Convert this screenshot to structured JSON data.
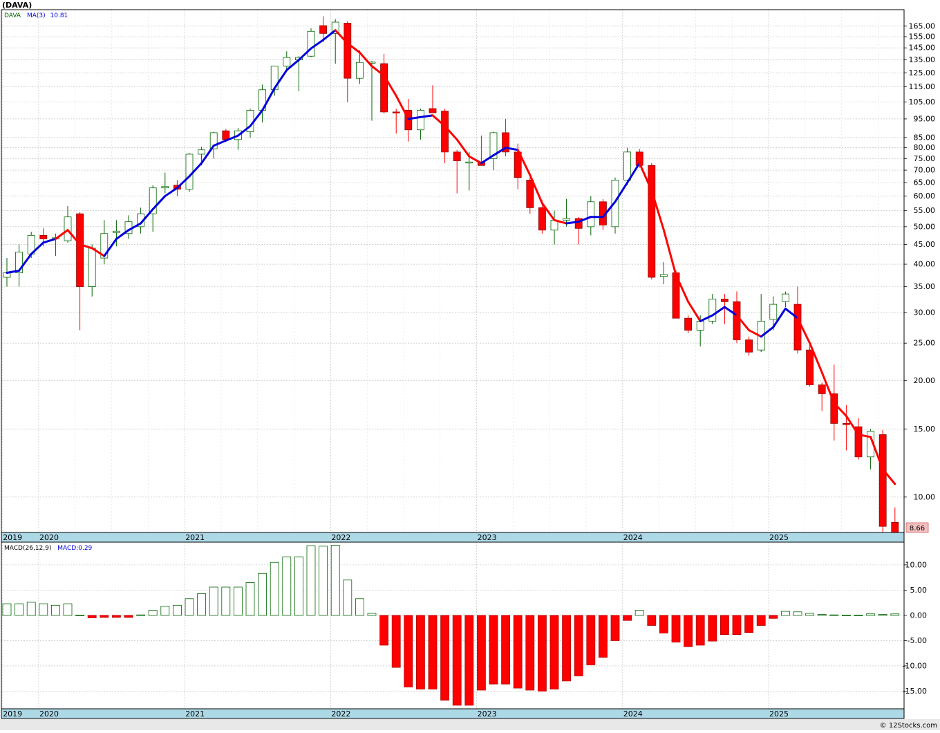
{
  "header": {
    "symbol": "(DAVA)"
  },
  "footer": {
    "credit": "© 12Stocks.com"
  },
  "colors": {
    "up": "#006400",
    "down": "#ff0000",
    "ma_up": "#0000dd",
    "ma_down": "#ff0000",
    "axis_band": "#add8e6",
    "grid": "#b8b8b8"
  },
  "chart_data": [
    {
      "type": "candlestick",
      "legend": {
        "symbol": "DAVA",
        "ma_label": "MA(3)",
        "ma_value": "10.81"
      },
      "last_price_label": "8.66",
      "y_scale": "log",
      "ylim": [
        8.1,
        182
      ],
      "y_ticks": [
        165,
        155,
        145,
        135,
        125,
        115,
        105,
        95,
        85,
        80,
        75,
        70,
        65,
        60,
        55,
        50,
        45,
        40,
        35,
        30,
        25,
        20,
        15,
        10
      ],
      "x_labels": [
        "2019",
        "2020",
        "2021",
        "2022",
        "2023",
        "2024",
        "2025"
      ],
      "x_label_positions": [
        0,
        3,
        15,
        27,
        39,
        51,
        63
      ],
      "grid": true,
      "candles": [
        {
          "o": 37,
          "h": 41.5,
          "l": 35,
          "c": 38
        },
        {
          "o": 38,
          "h": 45,
          "l": 35,
          "c": 43
        },
        {
          "o": 42.5,
          "h": 48.5,
          "l": 41.5,
          "c": 47.5
        },
        {
          "o": 47.5,
          "h": 49.5,
          "l": 44.5,
          "c": 46.5
        },
        {
          "o": 46.5,
          "h": 48,
          "l": 42,
          "c": 46.8
        },
        {
          "o": 46,
          "h": 56.5,
          "l": 45.5,
          "c": 53
        },
        {
          "o": 54,
          "h": 54.5,
          "l": 27,
          "c": 35
        },
        {
          "o": 35,
          "h": 45,
          "l": 33,
          "c": 44
        },
        {
          "o": 41.5,
          "h": 52,
          "l": 40,
          "c": 48
        },
        {
          "o": 48.3,
          "h": 52,
          "l": 44.5,
          "c": 48.7
        },
        {
          "o": 48,
          "h": 53.5,
          "l": 46.5,
          "c": 51.5
        },
        {
          "o": 50,
          "h": 56,
          "l": 48,
          "c": 54
        },
        {
          "o": 54,
          "h": 64,
          "l": 48.5,
          "c": 63
        },
        {
          "o": 63,
          "h": 69,
          "l": 61,
          "c": 63.5
        },
        {
          "o": 64,
          "h": 66,
          "l": 60,
          "c": 62.5
        },
        {
          "o": 62.5,
          "h": 77.5,
          "l": 61.5,
          "c": 77
        },
        {
          "o": 77,
          "h": 80.5,
          "l": 72,
          "c": 79
        },
        {
          "o": 79.5,
          "h": 88,
          "l": 75,
          "c": 87.5
        },
        {
          "o": 88.5,
          "h": 89.5,
          "l": 83,
          "c": 84
        },
        {
          "o": 84,
          "h": 90,
          "l": 79,
          "c": 88.5
        },
        {
          "o": 88,
          "h": 101,
          "l": 85,
          "c": 100
        },
        {
          "o": 100,
          "h": 116.5,
          "l": 93,
          "c": 113
        },
        {
          "o": 113,
          "h": 130,
          "l": 109,
          "c": 130
        },
        {
          "o": 130,
          "h": 142,
          "l": 127,
          "c": 137
        },
        {
          "o": 135,
          "h": 138,
          "l": 112,
          "c": 137
        },
        {
          "o": 138,
          "h": 163,
          "l": 137,
          "c": 160
        },
        {
          "o": 165.5,
          "h": 175,
          "l": 150,
          "c": 158
        },
        {
          "o": 158,
          "h": 172,
          "l": 132,
          "c": 169
        },
        {
          "o": 168,
          "h": 170,
          "l": 105,
          "c": 121
        },
        {
          "o": 121,
          "h": 143,
          "l": 117,
          "c": 133
        },
        {
          "o": 132.8,
          "h": 134,
          "l": 94,
          "c": 133.2
        },
        {
          "o": 132,
          "h": 140,
          "l": 98,
          "c": 99
        },
        {
          "o": 99,
          "h": 101,
          "l": 87,
          "c": 98.5
        },
        {
          "o": 100,
          "h": 107,
          "l": 83,
          "c": 89
        },
        {
          "o": 89,
          "h": 101,
          "l": 84,
          "c": 100
        },
        {
          "o": 101,
          "h": 116,
          "l": 99,
          "c": 98.5
        },
        {
          "o": 99.5,
          "h": 101,
          "l": 73,
          "c": 78
        },
        {
          "o": 78,
          "h": 79,
          "l": 61,
          "c": 74
        },
        {
          "o": 73.5,
          "h": 78,
          "l": 62,
          "c": 73.5
        },
        {
          "o": 73.5,
          "h": 86,
          "l": 72,
          "c": 72
        },
        {
          "o": 75,
          "h": 88,
          "l": 70,
          "c": 87.5
        },
        {
          "o": 87.5,
          "h": 95,
          "l": 76,
          "c": 78
        },
        {
          "o": 78,
          "h": 82,
          "l": 62.5,
          "c": 67
        },
        {
          "o": 66,
          "h": 67,
          "l": 54,
          "c": 56
        },
        {
          "o": 56,
          "h": 58.5,
          "l": 48,
          "c": 49
        },
        {
          "o": 49,
          "h": 55,
          "l": 45,
          "c": 52
        },
        {
          "o": 52,
          "h": 59,
          "l": 50,
          "c": 52.5
        },
        {
          "o": 52.5,
          "h": 53,
          "l": 45,
          "c": 49.5
        },
        {
          "o": 50,
          "h": 60,
          "l": 47.5,
          "c": 58
        },
        {
          "o": 58,
          "h": 59,
          "l": 49,
          "c": 50.5
        },
        {
          "o": 50,
          "h": 67,
          "l": 48,
          "c": 66
        },
        {
          "o": 66,
          "h": 80,
          "l": 64,
          "c": 78
        },
        {
          "o": 78,
          "h": 79.5,
          "l": 71,
          "c": 72
        },
        {
          "o": 72,
          "h": 73,
          "l": 36.5,
          "c": 37
        },
        {
          "o": 37.2,
          "h": 40.5,
          "l": 35.5,
          "c": 37.6
        },
        {
          "o": 38,
          "h": 38.5,
          "l": 29,
          "c": 29
        },
        {
          "o": 29,
          "h": 29.5,
          "l": 26.5,
          "c": 27
        },
        {
          "o": 27,
          "h": 29.5,
          "l": 24.5,
          "c": 28.5
        },
        {
          "o": 28.5,
          "h": 33.5,
          "l": 28,
          "c": 32.5
        },
        {
          "o": 32.5,
          "h": 33.5,
          "l": 28,
          "c": 32
        },
        {
          "o": 32,
          "h": 34,
          "l": 25,
          "c": 25.5
        },
        {
          "o": 25.5,
          "h": 26,
          "l": 23.2,
          "c": 23.7
        },
        {
          "o": 24,
          "h": 33.5,
          "l": 23.7,
          "c": 28.5
        },
        {
          "o": 28.8,
          "h": 33,
          "l": 27,
          "c": 31.5
        },
        {
          "o": 32,
          "h": 34,
          "l": 31,
          "c": 33.5
        },
        {
          "o": 31.5,
          "h": 35,
          "l": 23.5,
          "c": 24
        },
        {
          "o": 24,
          "h": 24.8,
          "l": 19.3,
          "c": 19.5
        },
        {
          "o": 19.5,
          "h": 19.8,
          "l": 16.7,
          "c": 18.5
        },
        {
          "o": 18.5,
          "h": 22,
          "l": 14,
          "c": 15.5
        },
        {
          "o": 15.5,
          "h": 17.3,
          "l": 13.2,
          "c": 15.4
        },
        {
          "o": 15.2,
          "h": 16,
          "l": 12.5,
          "c": 12.7
        },
        {
          "o": 12.7,
          "h": 15,
          "l": 11.8,
          "c": 14.8
        },
        {
          "o": 14.5,
          "h": 14.9,
          "l": 8.1,
          "c": 8.4
        },
        {
          "o": 8.6,
          "h": 9.4,
          "l": 8.1,
          "c": 8.1
        }
      ],
      "ma": [
        38,
        38.5,
        42.5,
        45.5,
        46.5,
        49,
        45,
        44,
        42,
        46.5,
        49,
        51,
        55.5,
        60,
        63,
        67.5,
        73,
        81,
        83.5,
        86,
        91,
        100,
        114,
        127,
        135,
        144.5,
        152,
        161,
        149,
        141,
        130,
        123,
        109,
        95,
        96,
        97,
        91,
        84,
        76,
        73,
        76.5,
        80,
        79,
        68,
        57.5,
        52,
        51,
        51.5,
        53,
        53,
        58,
        65,
        73,
        62,
        49,
        37.5,
        32,
        28.5,
        29.5,
        31,
        29.5,
        27,
        26,
        27.5,
        30.7,
        29,
        25,
        21,
        17.5,
        16.2,
        14.5,
        14.3,
        11.8,
        10.81
      ],
      "ma_color_switch": [
        1,
        1,
        1,
        1,
        0,
        0,
        0,
        0,
        1,
        1,
        1,
        1,
        1,
        1,
        1,
        1,
        1,
        1,
        1,
        1,
        1,
        1,
        1,
        1,
        1,
        1,
        1,
        0,
        0,
        0,
        0,
        0,
        0,
        1,
        1,
        0,
        0,
        0,
        0,
        1,
        1,
        1,
        0,
        0,
        0,
        0,
        1,
        1,
        1,
        1,
        1,
        1,
        0,
        0,
        0,
        0,
        0,
        1,
        1,
        1,
        0,
        0,
        1,
        1,
        1,
        0,
        0,
        0,
        0,
        0,
        0,
        0,
        0,
        0
      ]
    },
    {
      "type": "bar",
      "legend": {
        "name": "MACD(26,12,9)",
        "value_label": "MACD:0.29"
      },
      "ylim": [
        -18.5,
        14.5
      ],
      "y_ticks": [
        10,
        5,
        0,
        -5,
        -10,
        -15
      ],
      "y_tick_labels": [
        "10.00",
        "5.00",
        "0.00",
        "-5.00",
        "-10.00",
        "-15.00"
      ],
      "x_labels": [
        "2019",
        "2020",
        "2021",
        "2022",
        "2023",
        "2024",
        "2025"
      ],
      "x_label_positions": [
        0,
        3,
        15,
        27,
        39,
        51,
        63
      ],
      "grid": true,
      "values": [
        2.3,
        2.3,
        2.6,
        2.3,
        2.0,
        2.3,
        0.05,
        -0.5,
        -0.4,
        -0.4,
        -0.4,
        0.1,
        1.0,
        1.8,
        2.0,
        3.3,
        4.3,
        5.6,
        5.6,
        5.6,
        6.5,
        8.3,
        10.5,
        11.6,
        11.6,
        13.8,
        13.7,
        13.9,
        7.0,
        3.3,
        0.4,
        -5.9,
        -10.3,
        -14.2,
        -14.6,
        -14.6,
        -16.8,
        -17.8,
        -17.8,
        -14.8,
        -13.6,
        -13.6,
        -14.4,
        -14.8,
        -15.0,
        -14.6,
        -13.0,
        -12.0,
        -9.8,
        -8.3,
        -5.0,
        -1.0,
        1.0,
        -2.0,
        -3.5,
        -5.3,
        -6.2,
        -5.9,
        -5.1,
        -3.8,
        -3.8,
        -3.4,
        -2.0,
        -0.6,
        0.8,
        0.7,
        0.4,
        0.2,
        0.1,
        0.05,
        0.05,
        0.3,
        0.2,
        0.29
      ]
    }
  ]
}
